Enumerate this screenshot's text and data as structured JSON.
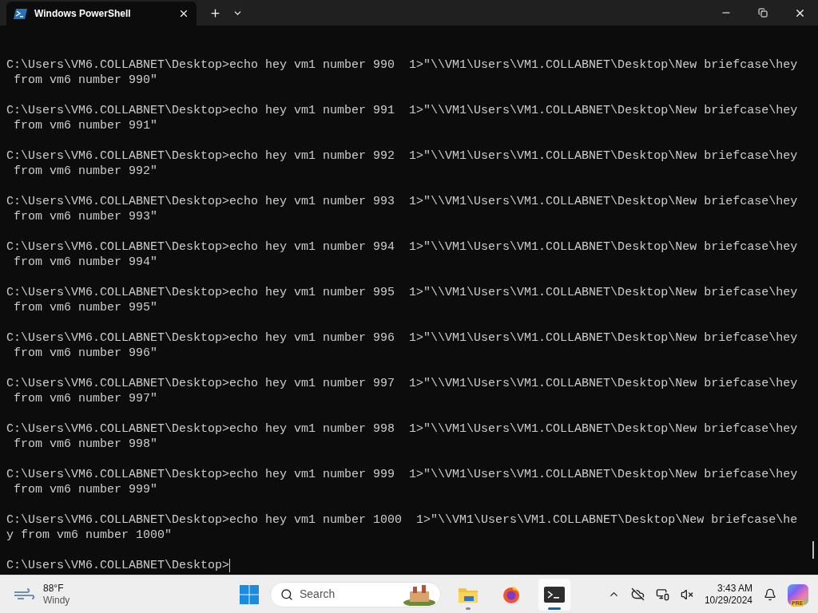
{
  "window": {
    "tab_title": "Windows PowerShell"
  },
  "terminal": {
    "blocks": [
      {
        "lines": [
          "C:\\Users\\VM6.COLLABNET\\Desktop>echo hey vm1 number 990  1>\"\\\\VM1\\Users\\VM1.COLLABNET\\Desktop\\New briefcase\\hey",
          " from vm6 number 990\""
        ]
      },
      {
        "lines": [
          "C:\\Users\\VM6.COLLABNET\\Desktop>echo hey vm1 number 991  1>\"\\\\VM1\\Users\\VM1.COLLABNET\\Desktop\\New briefcase\\hey",
          " from vm6 number 991\""
        ]
      },
      {
        "lines": [
          "C:\\Users\\VM6.COLLABNET\\Desktop>echo hey vm1 number 992  1>\"\\\\VM1\\Users\\VM1.COLLABNET\\Desktop\\New briefcase\\hey",
          " from vm6 number 992\""
        ]
      },
      {
        "lines": [
          "C:\\Users\\VM6.COLLABNET\\Desktop>echo hey vm1 number 993  1>\"\\\\VM1\\Users\\VM1.COLLABNET\\Desktop\\New briefcase\\hey",
          " from vm6 number 993\""
        ]
      },
      {
        "lines": [
          "C:\\Users\\VM6.COLLABNET\\Desktop>echo hey vm1 number 994  1>\"\\\\VM1\\Users\\VM1.COLLABNET\\Desktop\\New briefcase\\hey",
          " from vm6 number 994\""
        ]
      },
      {
        "lines": [
          "C:\\Users\\VM6.COLLABNET\\Desktop>echo hey vm1 number 995  1>\"\\\\VM1\\Users\\VM1.COLLABNET\\Desktop\\New briefcase\\hey",
          " from vm6 number 995\""
        ]
      },
      {
        "lines": [
          "C:\\Users\\VM6.COLLABNET\\Desktop>echo hey vm1 number 996  1>\"\\\\VM1\\Users\\VM1.COLLABNET\\Desktop\\New briefcase\\hey",
          " from vm6 number 996\""
        ]
      },
      {
        "lines": [
          "C:\\Users\\VM6.COLLABNET\\Desktop>echo hey vm1 number 997  1>\"\\\\VM1\\Users\\VM1.COLLABNET\\Desktop\\New briefcase\\hey",
          " from vm6 number 997\""
        ]
      },
      {
        "lines": [
          "C:\\Users\\VM6.COLLABNET\\Desktop>echo hey vm1 number 998  1>\"\\\\VM1\\Users\\VM1.COLLABNET\\Desktop\\New briefcase\\hey",
          " from vm6 number 998\""
        ]
      },
      {
        "lines": [
          "C:\\Users\\VM6.COLLABNET\\Desktop>echo hey vm1 number 999  1>\"\\\\VM1\\Users\\VM1.COLLABNET\\Desktop\\New briefcase\\hey",
          " from vm6 number 999\""
        ]
      },
      {
        "lines": [
          "C:\\Users\\VM6.COLLABNET\\Desktop>echo hey vm1 number 1000  1>\"\\\\VM1\\Users\\VM1.COLLABNET\\Desktop\\New briefcase\\he",
          "y from vm6 number 1000\""
        ]
      }
    ],
    "prompt": "C:\\Users\\VM6.COLLABNET\\Desktop>"
  },
  "taskbar": {
    "weather": {
      "temperature": "88°F",
      "condition": "Windy"
    },
    "search": {
      "placeholder": "Search"
    },
    "apps": [
      {
        "kind": "files",
        "running": true,
        "selected": false
      },
      {
        "kind": "browser",
        "running": false,
        "selected": false
      },
      {
        "kind": "terminal",
        "running": true,
        "selected": true
      }
    ],
    "clock": {
      "time": "3:43 AM",
      "date": "10/29/2024"
    },
    "copilot_badge": "PRE"
  }
}
